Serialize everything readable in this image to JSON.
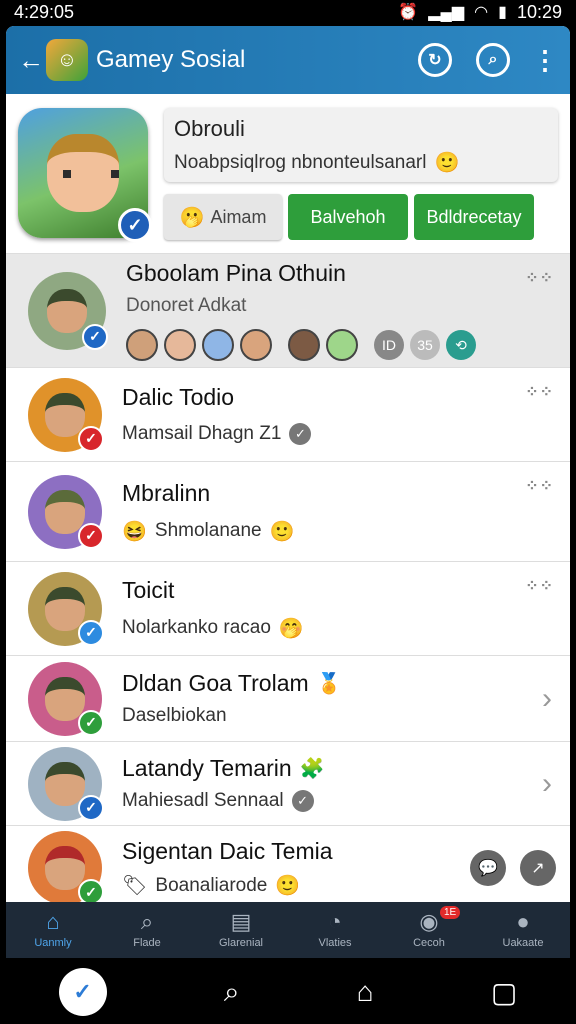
{
  "status_bar": {
    "time_left": "4:29:05",
    "time_right": "10:29"
  },
  "app_bar": {
    "title": "Gamey Sosial"
  },
  "profile": {
    "name": "Obrouli",
    "status": "Noabpsiqlrog nbnonteulsanarl",
    "actions": [
      "Aimam",
      "Balvehoh",
      "Bdldrecetay"
    ]
  },
  "chats": [
    {
      "title": "Gboolam Pina Othuin",
      "subtitle": "Donoret Adkat"
    },
    {
      "title": "Dalic Todio",
      "subtitle": "Mamsail Dhagn Z1"
    },
    {
      "title": "Mbralinn",
      "subtitle": "Shmolanane"
    },
    {
      "title": "Toicit",
      "subtitle": "Nolarkanko racao"
    },
    {
      "title": "Dldan Goa Trolam",
      "subtitle": "Daselbiokan"
    },
    {
      "title": "Latandy Temarin",
      "subtitle": "Mahiesadl Sennaal"
    },
    {
      "title": "Sigentan Daic Temia",
      "subtitle": "Boanaliarode"
    }
  ],
  "tabs": [
    "Uanmly",
    "Flade",
    "Glarenial",
    "Vlaties",
    "Cecoh",
    "Uakaate"
  ],
  "tab_badge": "1E",
  "colors": {
    "app_bar": "#2e88c4",
    "green": "#2e9e3b",
    "accent": "#4fa5ea"
  }
}
